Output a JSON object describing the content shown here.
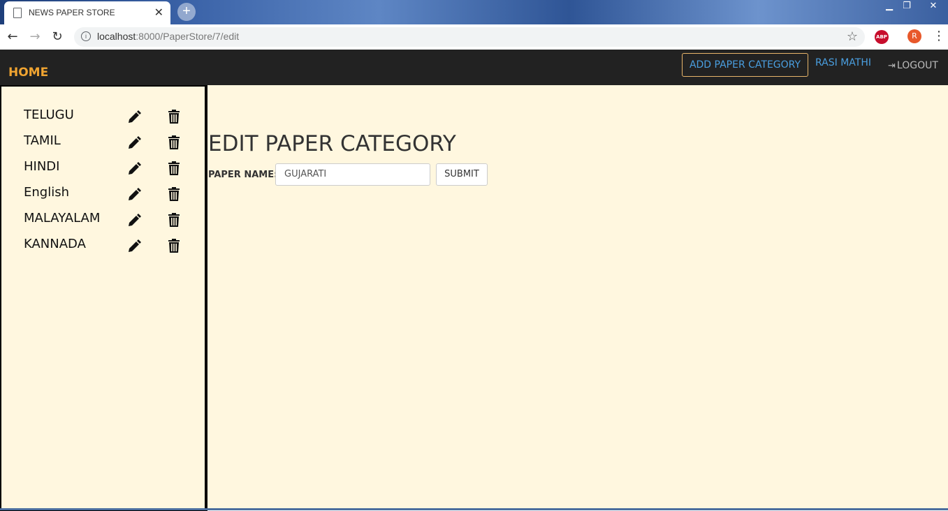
{
  "browser": {
    "tab_title": "NEWS PAPER STORE",
    "url_host": "localhost",
    "url_rest": ":8000/PaperStore/7/edit",
    "profile_initial": "R",
    "abp_label": "ABP"
  },
  "navbar": {
    "home_label": "HOME",
    "add_button_label": "ADD PAPER CATEGORY",
    "user_name": "RASI MATHI",
    "logout_label": "LOGOUT"
  },
  "sidebar": {
    "items": [
      {
        "label": "TELUGU"
      },
      {
        "label": "TAMIL"
      },
      {
        "label": "HINDI"
      },
      {
        "label": "English"
      },
      {
        "label": "MALAYALAM"
      },
      {
        "label": "KANNADA"
      }
    ]
  },
  "form": {
    "title": "EDIT PAPER CATEGORY",
    "label": "PAPER NAME",
    "label_suffix": ":",
    "input_value": "GUJARATI",
    "submit_label": "SUBMIT"
  },
  "colors": {
    "navbar_bg": "#222222",
    "home_accent": "#f0a431",
    "link_blue": "#4a9fe0",
    "content_bg": "#fff7df"
  }
}
